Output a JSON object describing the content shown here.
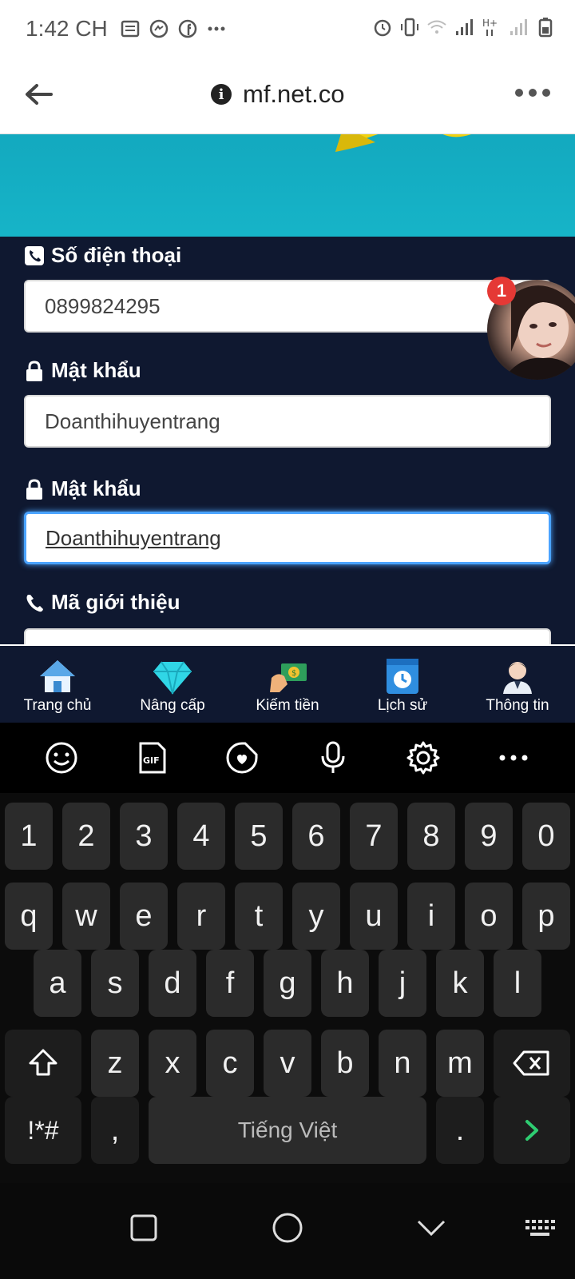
{
  "status_bar": {
    "time": "1:42 CH"
  },
  "browser": {
    "url": "mf.net.co"
  },
  "form": {
    "phone_label": "Số điện thoại",
    "phone_value": "0899824295",
    "password_label": "Mật khẩu",
    "password_value": "Doanthihuyentrang",
    "password_confirm_label": "Mật khẩu",
    "password_confirm_value": "Doanthihuyentrang",
    "referral_label": "Mã giới thiệu"
  },
  "chat": {
    "badge_count": "1"
  },
  "bottom_nav": [
    {
      "label": "Trang chủ",
      "icon": "home-icon"
    },
    {
      "label": "Nâng cấp",
      "icon": "diamond-icon"
    },
    {
      "label": "Kiếm tiền",
      "icon": "money-icon"
    },
    {
      "label": "Lịch sử",
      "icon": "history-icon"
    },
    {
      "label": "Thông tin",
      "icon": "profile-icon"
    }
  ],
  "keyboard": {
    "row_numbers": [
      "1",
      "2",
      "3",
      "4",
      "5",
      "6",
      "7",
      "8",
      "9",
      "0"
    ],
    "row1": [
      "q",
      "w",
      "e",
      "r",
      "t",
      "y",
      "u",
      "i",
      "o",
      "p"
    ],
    "row2": [
      "a",
      "s",
      "d",
      "f",
      "g",
      "h",
      "j",
      "k",
      "l"
    ],
    "row3": [
      "z",
      "x",
      "c",
      "v",
      "b",
      "n",
      "m"
    ],
    "symbols_key": "!*#",
    "comma_key": ",",
    "space_label": "Tiếng Việt",
    "period_key": "."
  },
  "colors": {
    "form_bg": "#0f1830",
    "banner": "#16b4c8",
    "focus": "#4aa3ff",
    "badge": "#e53935"
  }
}
